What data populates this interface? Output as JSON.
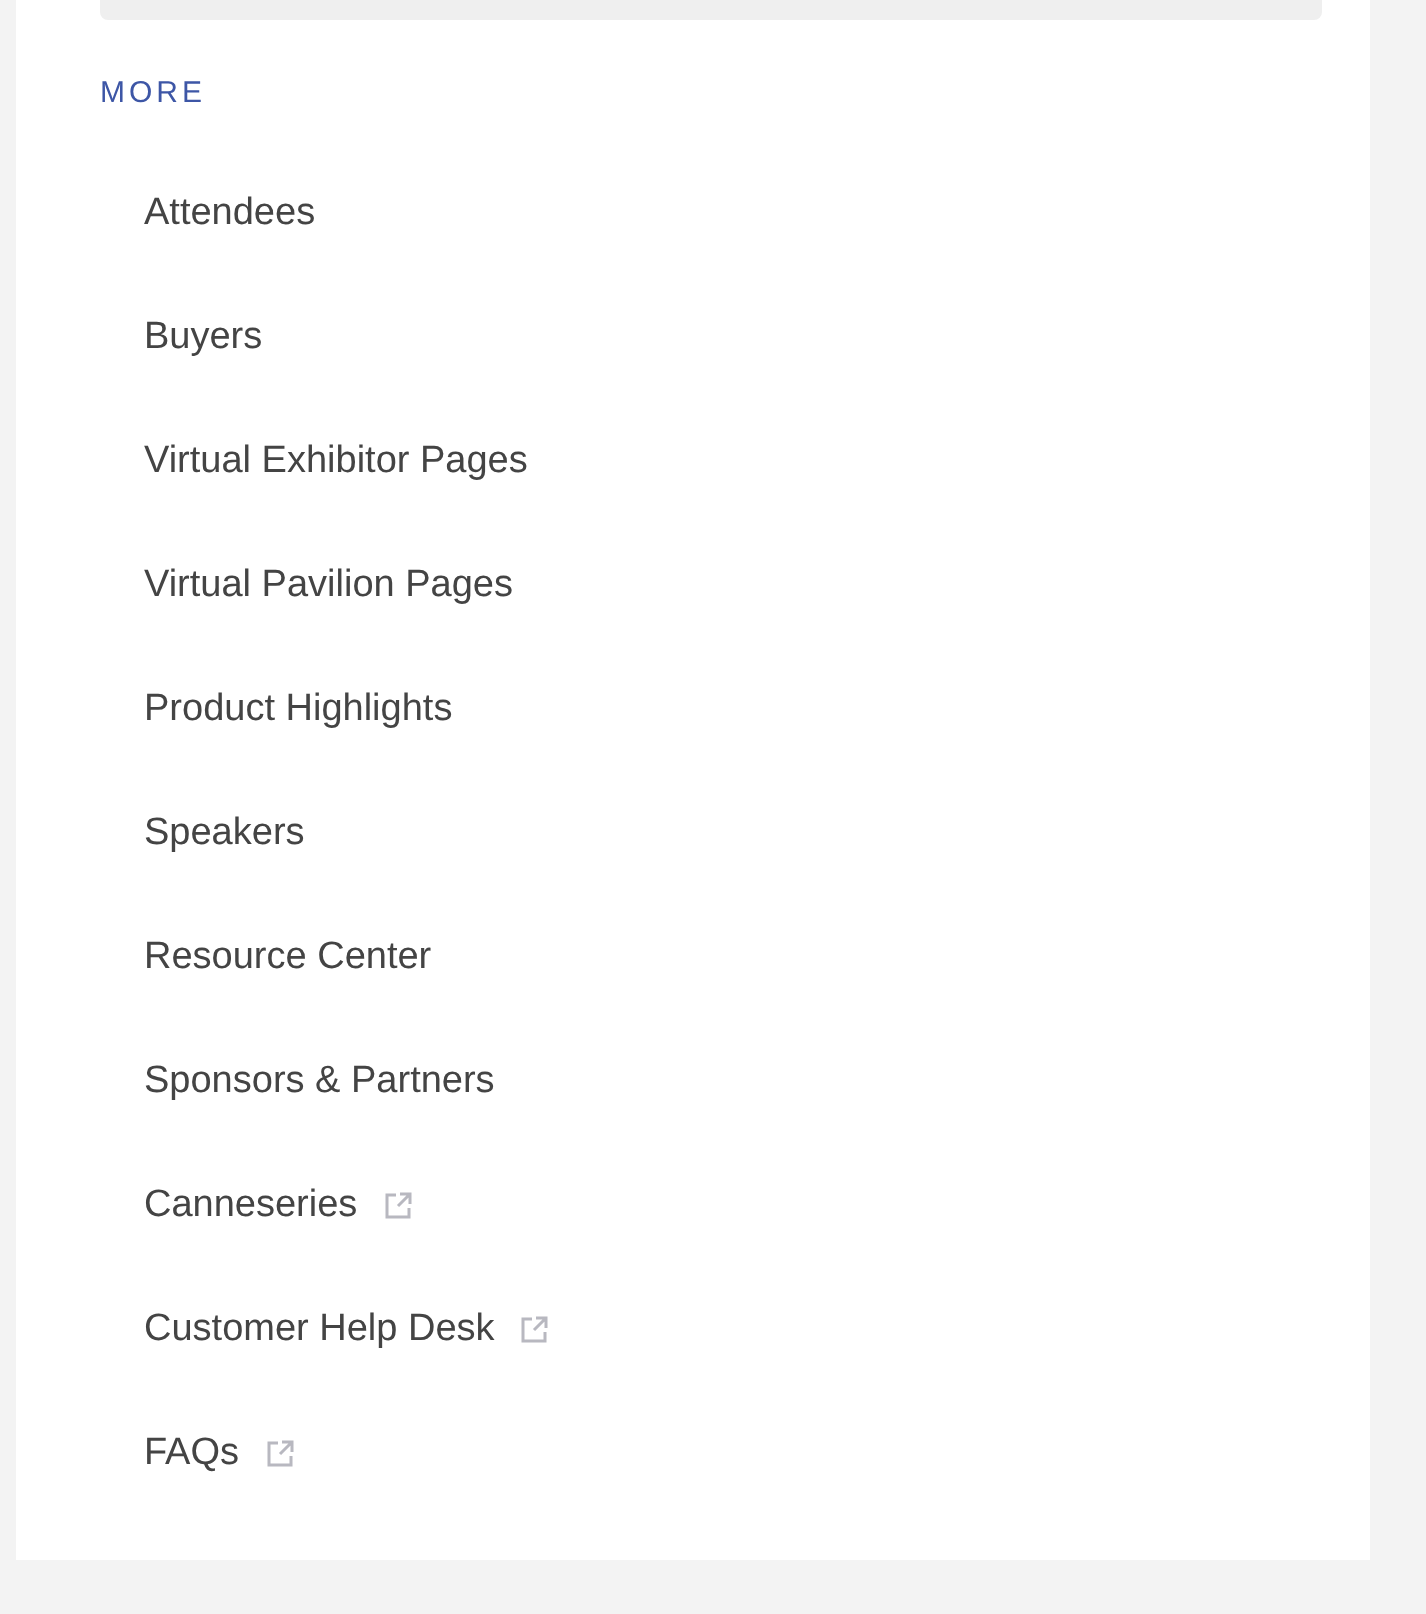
{
  "section": {
    "heading": "MORE"
  },
  "items": [
    {
      "label": "Attendees",
      "external": false
    },
    {
      "label": "Buyers",
      "external": false
    },
    {
      "label": "Virtual Exhibitor Pages",
      "external": false
    },
    {
      "label": "Virtual Pavilion Pages",
      "external": false
    },
    {
      "label": "Product Highlights",
      "external": false
    },
    {
      "label": "Speakers",
      "external": false
    },
    {
      "label": "Resource Center",
      "external": false
    },
    {
      "label": "Sponsors & Partners",
      "external": false
    },
    {
      "label": "Canneseries",
      "external": true
    },
    {
      "label": "Customer Help Desk",
      "external": true
    },
    {
      "label": "FAQs",
      "external": true
    }
  ]
}
